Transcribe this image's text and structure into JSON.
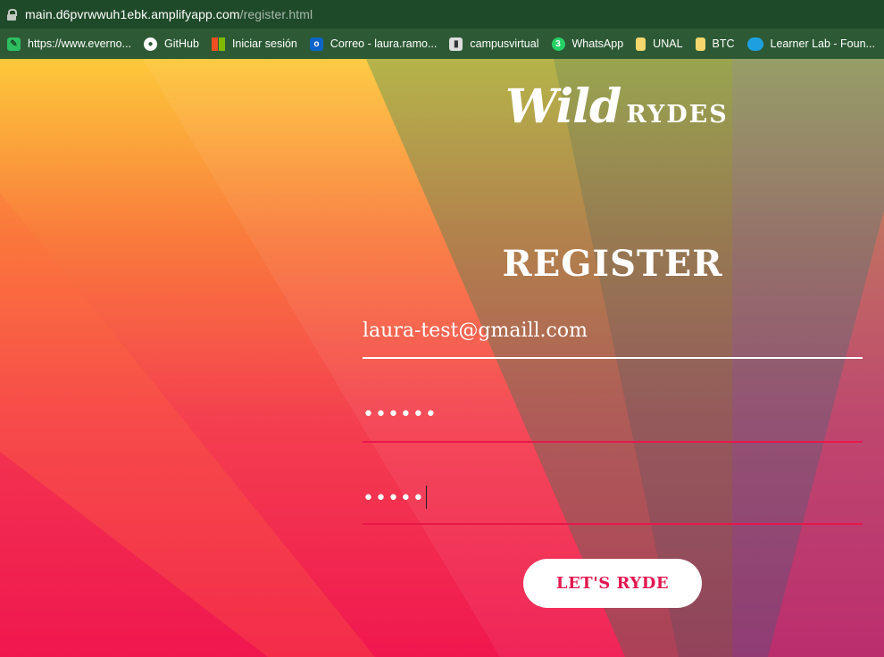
{
  "browser": {
    "url_host": "main.d6pvrwwuh1ebk.amplifyapp.com",
    "url_path": "/register.html",
    "bookmarks": [
      {
        "label": "https://www.everno...",
        "icon": "evernote-icon",
        "color": "#2dbe60"
      },
      {
        "label": "GitHub",
        "icon": "github-icon",
        "color": "#ffffff"
      },
      {
        "label": "Iniciar sesión",
        "icon": "microsoft-icon",
        "color": "#f25022"
      },
      {
        "label": "Correo - laura.ramo...",
        "icon": "outlook-icon",
        "color": "#0a64c8"
      },
      {
        "label": "campusvirtual",
        "icon": "campusvirtual-icon",
        "color": "#dddddd"
      },
      {
        "label": "WhatsApp",
        "icon": "whatsapp-icon",
        "color": "#25d366"
      },
      {
        "label": "UNAL",
        "icon": "folder-icon",
        "color": "#f5d76e"
      },
      {
        "label": "BTC",
        "icon": "folder-icon",
        "color": "#f5d76e"
      },
      {
        "label": "Learner Lab - Foun...",
        "icon": "salesforce-cloud-icon",
        "color": "#1ea0e0"
      }
    ]
  },
  "page": {
    "logo_wild": "Wild",
    "logo_rydes": "RYDES",
    "title": "REGISTER",
    "email_value": "laura-test@gmaill.com",
    "password_dots": "••••••",
    "confirm_dots": "•••••",
    "button_label": "LET'S RYDE"
  },
  "colors": {
    "accent": "#e3174f",
    "chrome_dark": "#1f4a2a",
    "chrome_bookmarks": "#2d5a35"
  }
}
